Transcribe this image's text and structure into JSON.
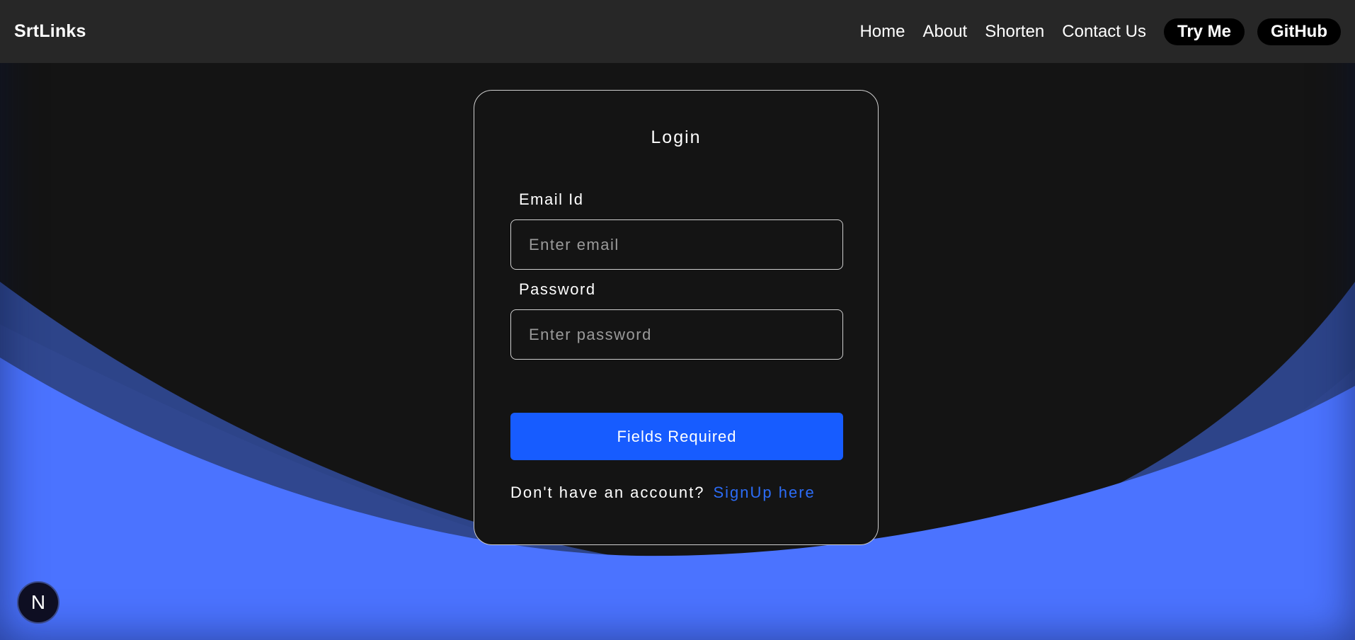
{
  "navbar": {
    "brand": "SrtLinks",
    "links": [
      "Home",
      "About",
      "Shorten",
      "Contact Us"
    ],
    "try_me": "Try Me",
    "github": "GitHub"
  },
  "login": {
    "title": "Login",
    "email_label": "Email Id",
    "email_placeholder": "Enter email",
    "email_value": "",
    "password_label": "Password",
    "password_placeholder": "Enter password",
    "password_value": "",
    "submit_label": "Fields Required",
    "signup_prompt": "Don't have an account?",
    "signup_link": "SignUp here"
  },
  "badge": {
    "letter": "N",
    "icon": "nextjs-logo-icon"
  },
  "colors": {
    "background": "#141414",
    "navbar": "#272727",
    "accent_button": "#175cff",
    "link": "#2c6cf6",
    "wave_light": "#4b73ff",
    "wave_dark": "#2e4690"
  }
}
